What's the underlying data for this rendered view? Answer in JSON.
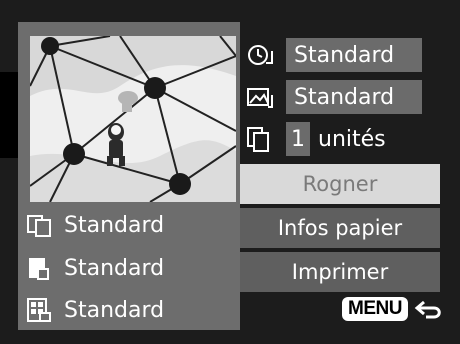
{
  "print_settings": {
    "date_value": "Standard",
    "file_no_value": "Standard",
    "copies_value": "1",
    "copies_unit": "unités"
  },
  "actions": {
    "crop_label": "Rogner",
    "paper_info_label": "Infos papier",
    "print_label": "Imprimer"
  },
  "summary": {
    "paper_size": "Standard",
    "paper_type": "Standard",
    "layout": "Standard"
  },
  "menu_label": "MENU",
  "colors": {
    "panel": "#6d6d6d",
    "selected_button": "#d9d9d9",
    "button": "#5f5f5f"
  }
}
